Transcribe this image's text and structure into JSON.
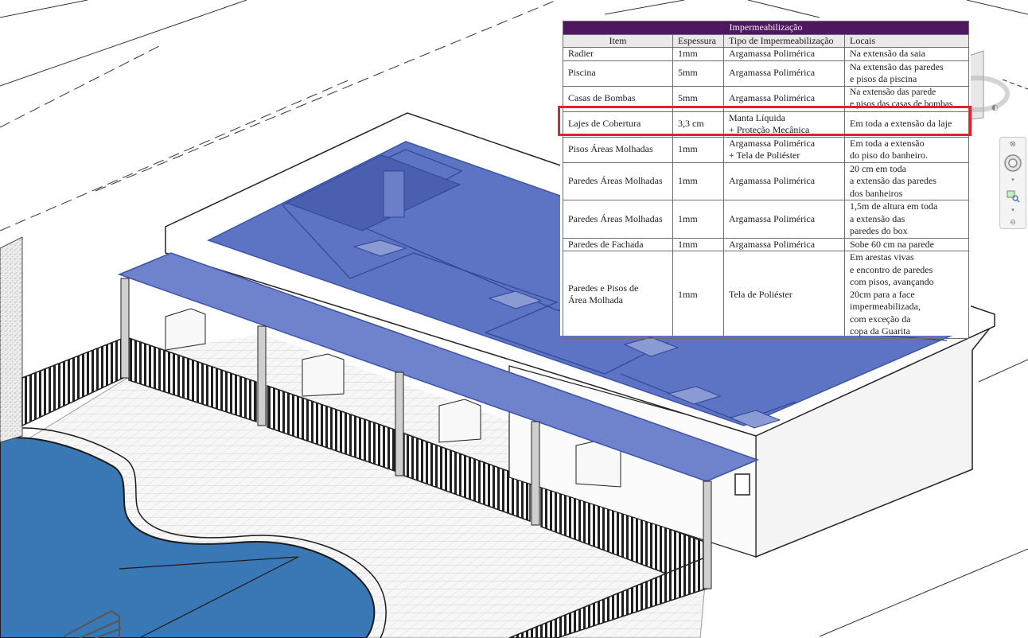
{
  "schedule": {
    "title": "Impermeabilização",
    "headers": [
      "Item",
      "Espessura",
      "Tipo de Impermeabilização",
      "Locais"
    ],
    "rows": [
      [
        "Radier",
        "1mm",
        "Argamassa Polimérica",
        "Na extensão da saia"
      ],
      [
        "Piscina",
        "5mm",
        "Argamassa Polimérica",
        "Na extensão das paredes\ne pisos da piscina"
      ],
      [
        "Casas de Bombas",
        "5mm",
        "Argamassa Polimérica",
        "Na extensão das parede\ne pisos das casas de bombas"
      ],
      [
        "Lajes de Cobertura",
        "3,3 cm",
        "Manta Líquida\n+ Proteção Mecânica",
        "Em toda a extensão da laje"
      ],
      [
        "Pisos Áreas Molhadas",
        "1mm",
        "Argamassa Polimérica\n+ Tela de Poliéster",
        "Em toda a extensão\ndo piso do banheiro."
      ],
      [
        "Paredes Áreas Molhadas",
        "1mm",
        "Argamassa Polimérica",
        "20 cm em toda\na extensão das paredes\ndos banheiros"
      ],
      [
        "Paredes Áreas Molhadas",
        "1mm",
        "Argamassa Polimérica",
        "1,5m de altura em toda\na extensão das\nparedes do box"
      ],
      [
        "Paredes de Fachada",
        "1mm",
        "Argamassa Polimérica",
        "Sobe 60 cm na parede"
      ],
      [
        "Paredes e Pisos de\nÁrea Molhada",
        "1mm",
        "Tela de Poliéster",
        "Em arestas vivas\ne encontro de paredes\ncom pisos, avançando\n20cm para a face\nimpermeabilizada,\ncom exceção da\ncopa da Guarita"
      ]
    ],
    "highlighted_row": 3
  },
  "nav_bar": {
    "icons": [
      "close-icon",
      "full-navigation-wheel-icon",
      "chevron-down-icon",
      "zoom-region-icon",
      "chevron-down-icon",
      "collapse-icon"
    ]
  },
  "colors": {
    "header_band": "#4e1760",
    "highlight": "#e3212b",
    "selection_blue": "#5d73c4",
    "pool_water": "#3a78b5"
  }
}
